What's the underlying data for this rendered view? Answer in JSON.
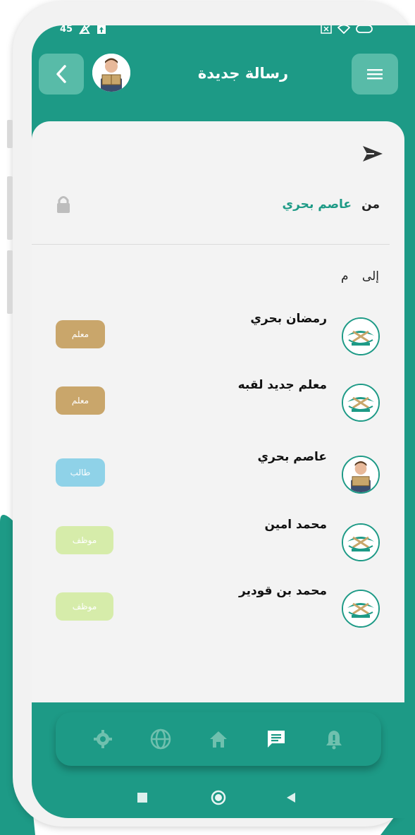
{
  "status_bar": {
    "time_fragment": "45",
    "icons": [
      "notification-off-icon",
      "upload-icon",
      "close-box-icon",
      "wifi-icon",
      "battery-icon"
    ]
  },
  "header": {
    "title": "رسالة جديدة",
    "back_icon": "chevron-left-icon",
    "menu_icon": "hamburger-menu-icon",
    "colors": {
      "primary": "#1d9a86",
      "button": "#58bba8"
    }
  },
  "compose": {
    "send_icon": "send-icon",
    "from_label": "من",
    "from_name": "عاصم بحري",
    "lock_icon": "lock-icon",
    "to_label": "إلى",
    "to_input_value": "م"
  },
  "recipients": [
    {
      "name": "رمضان بحري",
      "role": "معلم",
      "avatar": "logo",
      "role_color": "#c9a66b"
    },
    {
      "name": "معلم جديد لقبه",
      "role": "معلم",
      "avatar": "logo",
      "role_color": "#c9a66b"
    },
    {
      "name": "عاصم بحري",
      "role": "طالب",
      "avatar": "photo",
      "role_color": "#8fd2e8"
    },
    {
      "name": "محمد امين",
      "role": "موظف",
      "avatar": "logo",
      "role_color": "#d6ecaa"
    },
    {
      "name": "محمد بن قودير",
      "role": "موظف",
      "avatar": "logo",
      "role_color": "#d6ecaa"
    }
  ],
  "bottom_nav": {
    "items": [
      {
        "icon": "settings-icon",
        "active": false
      },
      {
        "icon": "globe-icon",
        "active": false
      },
      {
        "icon": "home-icon",
        "active": false
      },
      {
        "icon": "message-icon",
        "active": true
      },
      {
        "icon": "bell-icon",
        "active": false
      }
    ]
  },
  "system_nav": {
    "items": [
      "recents-square-icon",
      "home-circle-icon",
      "back-triangle-icon"
    ]
  }
}
